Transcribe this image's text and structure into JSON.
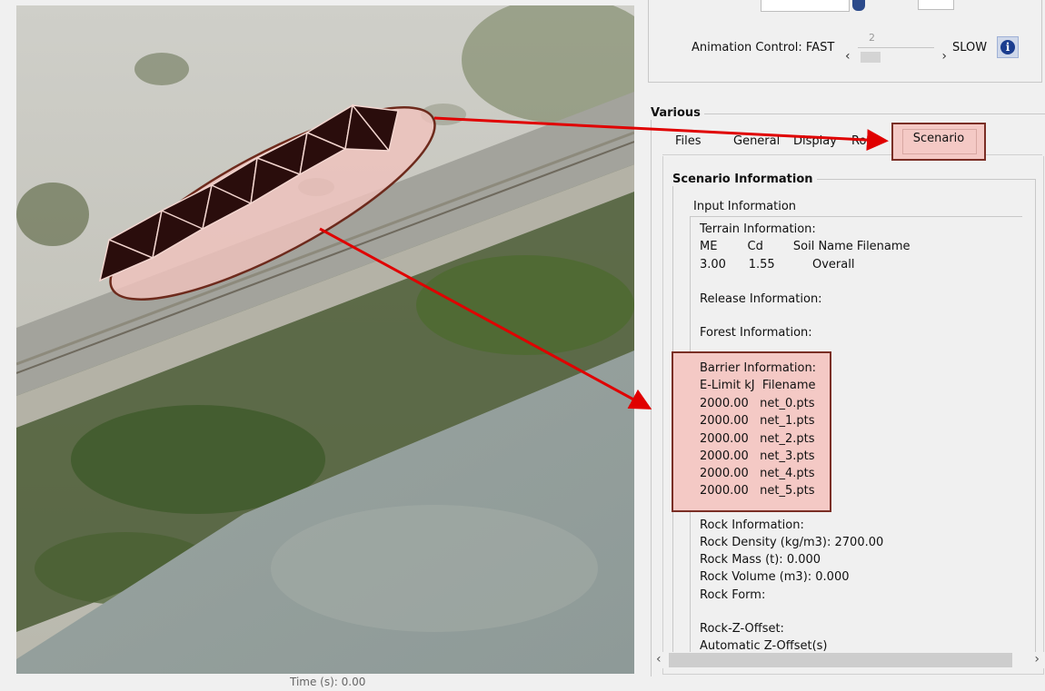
{
  "viewer": {
    "time_label": "Time (s): 0.00"
  },
  "animation": {
    "label": "Animation Control: FAST",
    "value": "2",
    "slow_label": "SLOW",
    "left_arrow": "‹",
    "right_arrow": "›",
    "info_glyph": "i",
    "info_icon": "info-icon"
  },
  "various": {
    "legend": "Various",
    "tabs": [
      "Files",
      "General",
      "Display",
      "Rock",
      "Scenario"
    ],
    "active_tab": "Scenario"
  },
  "scenario": {
    "legend": "Scenario Information",
    "input_info": "Input Information",
    "terrain_title": "Terrain Information:",
    "terrain_header": "ME        Cd        Soil Name Filename",
    "terrain_row": "3.00      1.55          Overall",
    "release_title": "Release Information:",
    "forest_title": "Forest Information:",
    "barrier_title": "Barrier Information:",
    "barrier_header": "E-Limit kJ  Filename",
    "barriers": [
      "2000.00   net_0.pts",
      "2000.00   net_1.pts",
      "2000.00   net_2.pts",
      "2000.00   net_3.pts",
      "2000.00   net_4.pts",
      "2000.00   net_5.pts"
    ],
    "rock_title": "Rock Information:",
    "rock_density": "Rock Density (kg/m3): 2700.00",
    "rock_mass": "Rock Mass (t): 0.000",
    "rock_volume": "Rock Volume (m3): 0.000",
    "rock_form": "Rock Form:",
    "rock_z_offset": "Rock-Z-Offset:",
    "auto_z_offset": "Automatic Z-Offset(s)"
  },
  "colors": {
    "highlight_fill": "#f4c9c5",
    "highlight_border": "#7a2e25",
    "arrow": "#e00000"
  }
}
